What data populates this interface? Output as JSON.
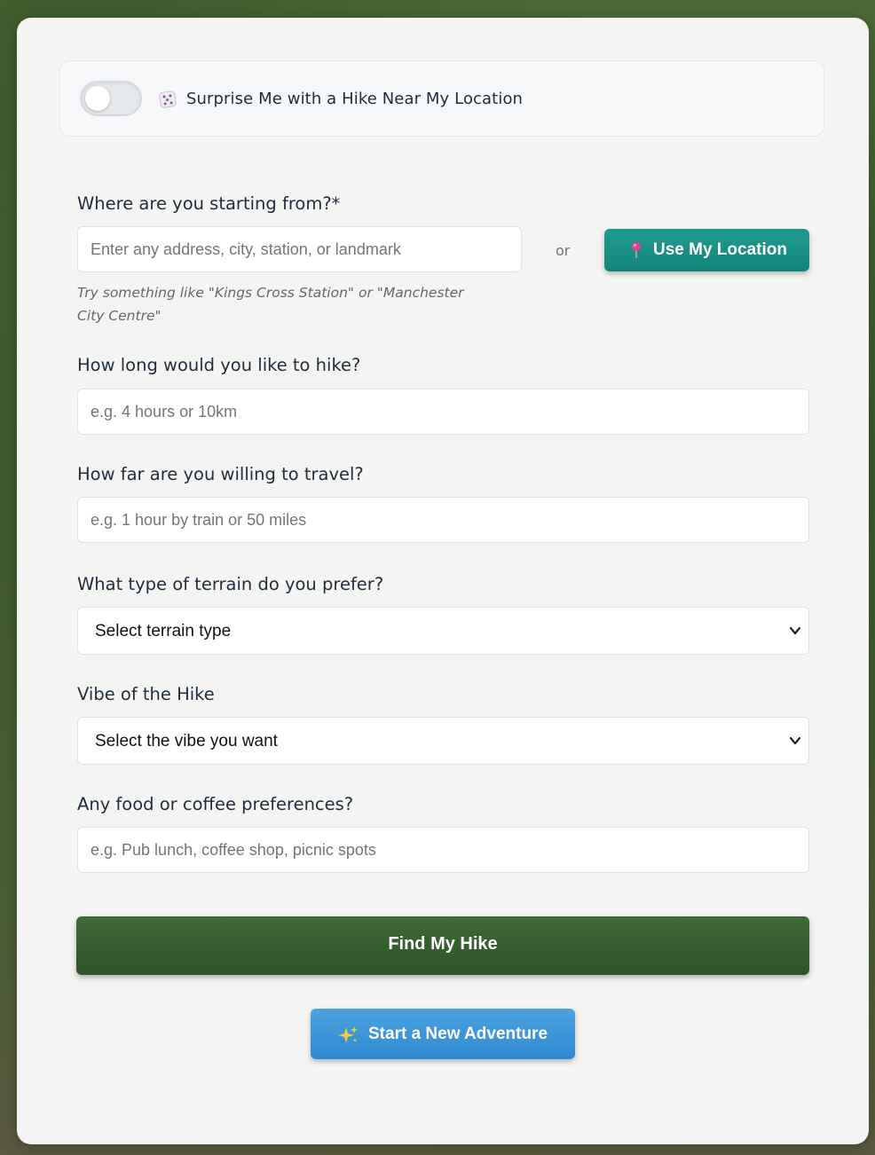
{
  "surprise": {
    "enabled": false,
    "label": "Surprise Me with a Hike Near My Location",
    "icon": "dice-icon"
  },
  "start": {
    "label": "Where are you starting from?*",
    "placeholder": "Enter any address, city, station, or landmark",
    "value": "",
    "or_text": "or",
    "location_button": "Use My Location",
    "location_icon": "pin-icon",
    "hint": "Try something like \"Kings Cross Station\" or \"Manchester City Centre\""
  },
  "duration": {
    "label": "How long would you like to hike?",
    "placeholder": "e.g. 4 hours or 10km",
    "value": ""
  },
  "travel": {
    "label": "How far are you willing to travel?",
    "placeholder": "e.g. 1 hour by train or 50 miles",
    "value": ""
  },
  "terrain": {
    "label": "What type of terrain do you prefer?",
    "selected": "Select terrain type"
  },
  "vibe": {
    "label": "Vibe of the Hike",
    "selected": "Select the vibe you want"
  },
  "food": {
    "label": "Any food or coffee preferences?",
    "placeholder": "e.g. Pub lunch, coffee shop, picnic spots",
    "value": ""
  },
  "actions": {
    "find": "Find My Hike",
    "new_adventure": "Start a New Adventure",
    "new_adventure_icon": "sparkles-icon"
  },
  "colors": {
    "teal_button": "#13867c",
    "green_button": "#2d5428",
    "blue_button": "#2f89cf"
  }
}
